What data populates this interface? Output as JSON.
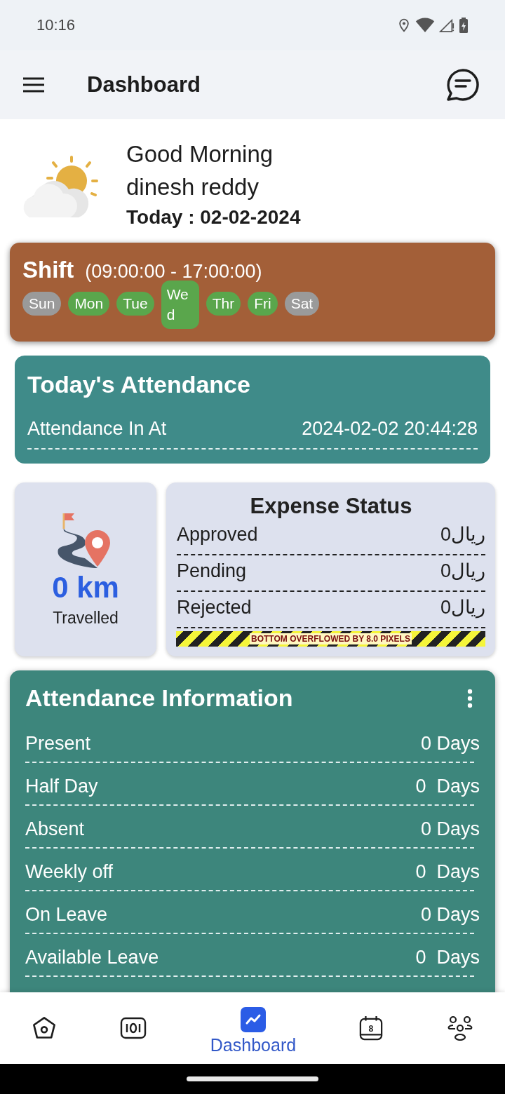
{
  "status_bar": {
    "time": "10:16"
  },
  "app_bar": {
    "title": "Dashboard"
  },
  "greeting": {
    "salutation": "Good Morning",
    "name": "dinesh reddy",
    "date": "Today : 02-02-2024"
  },
  "shift": {
    "title": "Shift",
    "hours": "(09:00:00 - 17:00:00)",
    "days": [
      {
        "label": "Sun",
        "on": false
      },
      {
        "label": "Mon",
        "on": true
      },
      {
        "label": "Tue",
        "on": true
      },
      {
        "label": "Wed",
        "on": true,
        "wrapped": true
      },
      {
        "label": "Thr",
        "on": true
      },
      {
        "label": "Fri",
        "on": true
      },
      {
        "label": "Sat",
        "on": false
      }
    ]
  },
  "todays_attendance": {
    "title": "Today's Attendance",
    "label": "Attendance In At",
    "value": "2024-02-02 20:44:28"
  },
  "travel": {
    "distance": "0 km",
    "label": "Travelled"
  },
  "expense_status": {
    "title": "Expense Status",
    "rows": [
      {
        "label": "Approved",
        "value": "0ريال"
      },
      {
        "label": "Pending",
        "value": "0ريال"
      },
      {
        "label": "Rejected",
        "value": "0ريال"
      }
    ],
    "overflow_warning": "BOTTOM OVERFLOWED BY 8.0 PIXELS"
  },
  "attendance_information": {
    "title": "Attendance Information",
    "rows": [
      {
        "label": "Present",
        "value": "0 Days"
      },
      {
        "label": "Half Day",
        "value": "0  Days"
      },
      {
        "label": "Absent",
        "value": "0 Days"
      },
      {
        "label": "Weekly off",
        "value": "0  Days"
      },
      {
        "label": "On Leave",
        "value": "0 Days"
      },
      {
        "label": "Available Leave",
        "value": "0  Days"
      }
    ]
  },
  "bottom_nav": [
    {
      "kind": "home",
      "selected": false
    },
    {
      "kind": "counter",
      "selected": false
    },
    {
      "kind": "dashboard",
      "label": "Dashboard",
      "selected": true
    },
    {
      "kind": "calendar",
      "day": "8",
      "selected": false
    },
    {
      "kind": "team",
      "selected": false
    }
  ]
}
